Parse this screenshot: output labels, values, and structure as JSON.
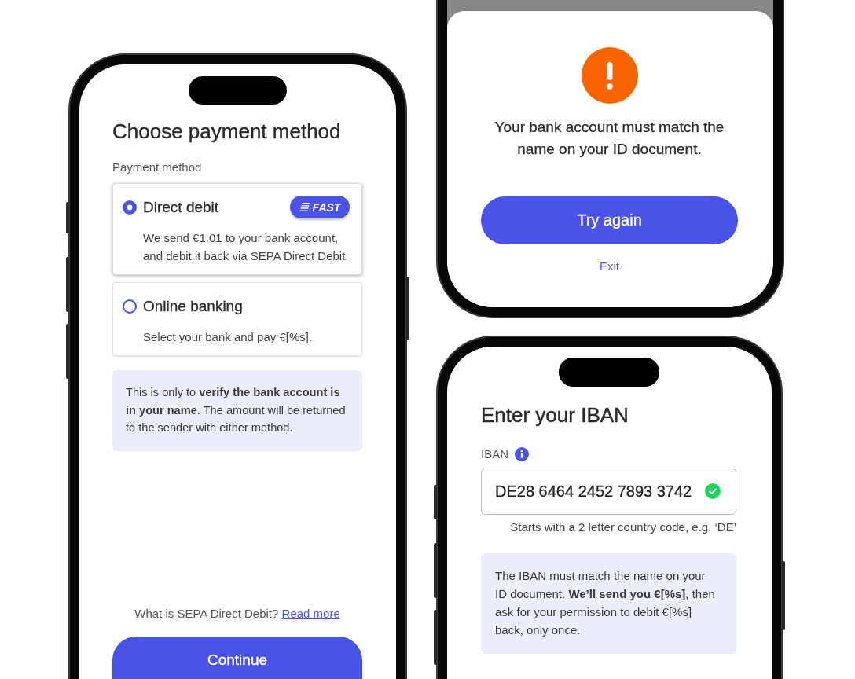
{
  "payment_screen": {
    "title": "Choose payment method",
    "field_label": "Payment method",
    "options": [
      {
        "label": "Direct debit",
        "selected": true,
        "badge": "FAST",
        "description": "We send €1.01 to your bank account, and debit it back via SEPA Direct Debit."
      },
      {
        "label": "Online banking",
        "selected": false,
        "description": "Select your bank and pay €[%s]."
      }
    ],
    "notice": "This is only to **verify the bank account is in your name**. The amount will be returned to the sender with either method.",
    "help_text": "What is SEPA Direct Debit?",
    "help_link": "Read more",
    "primary_button": "Continue"
  },
  "error_sheet": {
    "message": "Your bank account must match the name on your ID document.",
    "primary_button": "Try again",
    "secondary_link": "Exit"
  },
  "iban_screen": {
    "title": "Enter your IBAN",
    "field_label": "IBAN",
    "iban_field": {
      "value": "DE28 6464 2452 7893 3742",
      "valid": true
    },
    "hint": "Starts with a 2 letter country code, e.g. ‘DE’",
    "notice": "The IBAN must match the name on your ID document. **We’ll send you €[%s]**, then ask for your permission to debit €[%s] back, only once."
  }
}
